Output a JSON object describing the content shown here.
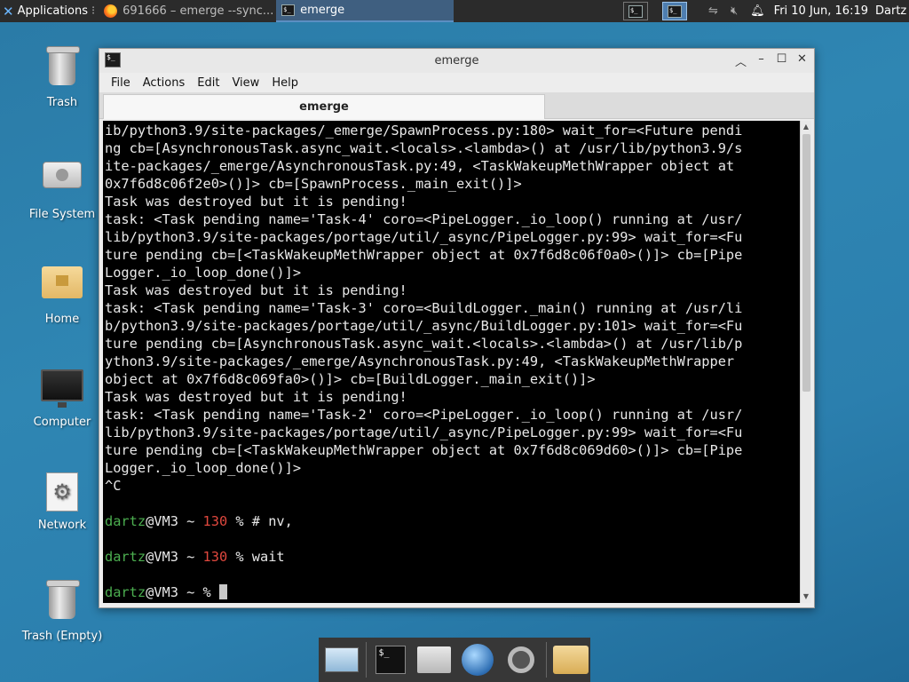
{
  "top_panel": {
    "apps_menu_label": "Applications",
    "tasks": [
      {
        "label": "691666 – emerge --sync...",
        "icon": "firefox-icon",
        "active": false
      },
      {
        "label": "emerge",
        "icon": "terminal-icon",
        "active": true
      }
    ],
    "datetime": "Fri 10 Jun, 16:19",
    "user": "Dartz"
  },
  "desktop_icons": [
    {
      "label": "Trash",
      "icon": "trash-icon"
    },
    {
      "label": "File System",
      "icon": "hard-drive-icon"
    },
    {
      "label": "Home",
      "icon": "home-folder-icon"
    },
    {
      "label": "Computer",
      "icon": "monitor-icon"
    },
    {
      "label": "Network",
      "icon": "network-icon"
    },
    {
      "label": "Trash (Empty)",
      "icon": "trash-icon"
    }
  ],
  "window": {
    "title": "emerge",
    "menu": [
      "File",
      "Actions",
      "Edit",
      "View",
      "Help"
    ],
    "tab_label": "emerge",
    "terminal": {
      "lines": [
        "ib/python3.9/site-packages/_emerge/SpawnProcess.py:180> wait_for=<Future pendi",
        "ng cb=[AsynchronousTask.async_wait.<locals>.<lambda>() at /usr/lib/python3.9/s",
        "ite-packages/_emerge/AsynchronousTask.py:49, <TaskWakeupMethWrapper object at",
        "0x7f6d8c06f2e0>()]> cb=[SpawnProcess._main_exit()]>",
        "Task was destroyed but it is pending!",
        "task: <Task pending name='Task-4' coro=<PipeLogger._io_loop() running at /usr/",
        "lib/python3.9/site-packages/portage/util/_async/PipeLogger.py:99> wait_for=<Fu",
        "ture pending cb=[<TaskWakeupMethWrapper object at 0x7f6d8c06f0a0>()]> cb=[Pipe",
        "Logger._io_loop_done()]>",
        "Task was destroyed but it is pending!",
        "task: <Task pending name='Task-3' coro=<BuildLogger._main() running at /usr/li",
        "b/python3.9/site-packages/portage/util/_async/BuildLogger.py:101> wait_for=<Fu",
        "ture pending cb=[AsynchronousTask.async_wait.<locals>.<lambda>() at /usr/lib/p",
        "ython3.9/site-packages/_emerge/AsynchronousTask.py:49, <TaskWakeupMethWrapper",
        "object at 0x7f6d8c069fa0>()]> cb=[BuildLogger._main_exit()]>",
        "Task was destroyed but it is pending!",
        "task: <Task pending name='Task-2' coro=<PipeLogger._io_loop() running at /usr/",
        "lib/python3.9/site-packages/portage/util/_async/PipeLogger.py:99> wait_for=<Fu",
        "ture pending cb=[<TaskWakeupMethWrapper object at 0x7f6d8c069d60>()]> cb=[Pipe",
        "Logger._io_loop_done()]>",
        "^C"
      ],
      "prompts": [
        {
          "user": "dartz",
          "host": "@VM3 ~ ",
          "code": "130",
          "symbol": " % ",
          "command": "# nv,"
        },
        {
          "user": "dartz",
          "host": "@VM3 ~ ",
          "code": "130",
          "symbol": " % ",
          "command": "wait"
        },
        {
          "user": "dartz",
          "host": "@VM3 ~ ",
          "code": "",
          "symbol": "% ",
          "command": ""
        }
      ]
    }
  },
  "dock": [
    "show-desktop-icon",
    "terminal-icon",
    "file-manager-icon",
    "web-browser-icon",
    "app-finder-icon",
    "folder-icon"
  ],
  "colors": {
    "prompt_user": "#4caf50",
    "exit_code": "#e0483e",
    "desktop": "#2f86b3",
    "panel": "#2b2b2b"
  }
}
